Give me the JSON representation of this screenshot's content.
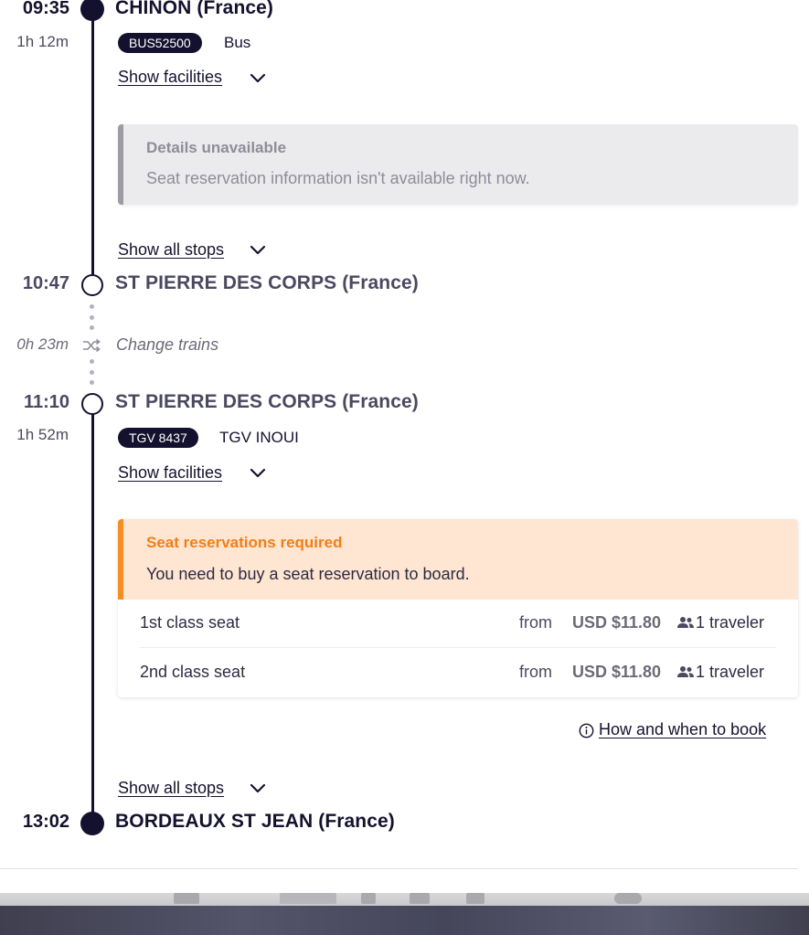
{
  "legs": {
    "first": {
      "depart_time": "09:35",
      "depart_station": "CHINON (France)",
      "duration": "1h 12m",
      "service_code": "BUS52500",
      "service_type": "Bus",
      "show_facilities": "Show facilities",
      "notice_title": "Details unavailable",
      "notice_body": "Seat reservation information isn't available right now.",
      "show_all_stops": "Show all stops",
      "arrive_time": "10:47",
      "arrive_station": "ST PIERRE DES CORPS (France)"
    },
    "transfer": {
      "duration": "0h 23m",
      "label": "Change trains"
    },
    "second": {
      "depart_time": "11:10",
      "depart_station": "ST PIERRE DES CORPS (France)",
      "duration": "1h 52m",
      "service_code": "TGV 8437",
      "service_type": "TGV INOUI",
      "show_facilities": "Show facilities",
      "notice_title": "Seat reservations required",
      "notice_body": "You need to buy a seat reservation to board.",
      "seats": [
        {
          "name": "1st class seat",
          "from": "from",
          "price": "USD $11.80",
          "travelers": "1 traveler"
        },
        {
          "name": "2nd class seat",
          "from": "from",
          "price": "USD $11.80",
          "travelers": "1 traveler"
        }
      ],
      "how_to_book": "How and when to book",
      "show_all_stops": "Show all stops",
      "arrive_time": "13:02",
      "arrive_station": "BORDEAUX ST JEAN (France)"
    }
  },
  "icons": {
    "chevron": "chevron-down-icon",
    "shuffle": "shuffle-icon",
    "travelers": "people-icon",
    "info": "info-icon"
  },
  "colors": {
    "navy": "#14112f",
    "warning_orange": "#f47d13",
    "warning_bg": "#ffe6d2",
    "muted_gray": "#8e8d98"
  }
}
